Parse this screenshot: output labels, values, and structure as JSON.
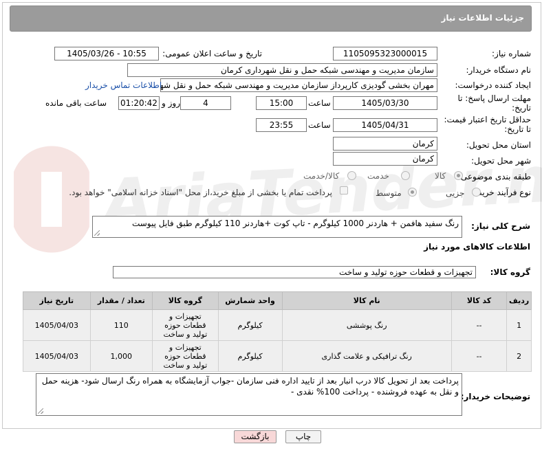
{
  "header": {
    "title": "جزئیات اطلاعات نیاز"
  },
  "fields": {
    "need_number_label": "شماره نیاز:",
    "need_number_value": "1105095323000015",
    "announce_label": "تاریخ و ساعت اعلان عمومی:",
    "announce_value": "1405/03/26 - 10:55",
    "buyer_org_label": "نام دستگاه خریدار:",
    "buyer_org_value": "سازمان مدیریت و مهندسی شبکه حمل و نقل شهرداری کرمان",
    "requester_label": "ایجاد کننده درخواست:",
    "requester_value": "مهران بخشی گودیزی کارپرداز سازمان مدیریت و مهندسی شبکه حمل و نقل شهرداری کرمان",
    "contact_link": "اطلاعات تماس خریدار",
    "deadline_label_1": "مهلت ارسال پاسخ: تا",
    "deadline_label_2": "تاریخ:",
    "deadline_date": "1405/03/30",
    "time_label": "ساعت",
    "deadline_time": "15:00",
    "days_value": "4",
    "days_label": "روز و",
    "remaining_value": "01:20:42",
    "remaining_label": "ساعت باقی مانده",
    "validity_label_1": "حداقل تاریخ اعتبار قیمت:",
    "validity_label_2": "تا تاریخ:",
    "validity_date": "1405/04/31",
    "validity_time": "23:55",
    "province_label": "استان محل تحویل:",
    "province_value": "کرمان",
    "city_label": "شهر محل تحویل:",
    "city_value": "کرمان",
    "category_label": "طبقه بندی موضوعی:",
    "category_options": [
      "کالا",
      "خدمت",
      "کالا/خدمت"
    ],
    "category_selected": "کالا",
    "process_label": "نوع فرآیند خرید :",
    "process_options": [
      "جزیی",
      "متوسط"
    ],
    "process_selected": "متوسط",
    "payment_note": "پرداخت تمام یا بخشی از مبلغ خرید،از محل \"اسناد خزانه اسلامی\" خواهد بود."
  },
  "description": {
    "label": "شرح کلی نیاز:",
    "value": "رنگ سفید هافمن + هاردنر 1000 کیلوگرم - تاپ کوت +هاردنر 110 کیلوگرم طبق فایل پیوست"
  },
  "goods_section": {
    "title": "اطلاعات کالاهای مورد نیاز",
    "group_label": "گروه کالا:",
    "group_value": "تجهیزات و قطعات حوزه تولید و ساخت"
  },
  "table": {
    "headers": [
      "ردیف",
      "کد کالا",
      "نام کالا",
      "واحد شمارش",
      "گروه کالا",
      "تعداد / مقدار",
      "تاریخ نیاز"
    ],
    "rows": [
      {
        "row": "1",
        "code": "--",
        "name": "رنگ پوششی",
        "unit": "کیلوگرم",
        "group": "تجهیزات و قطعات حوزه تولید و ساخت",
        "qty": "110",
        "date": "1405/04/03"
      },
      {
        "row": "2",
        "code": "--",
        "name": "رنگ ترافیکی و علامت گذاری",
        "unit": "کیلوگرم",
        "group": "تجهیزات و قطعات حوزه تولید و ساخت",
        "qty": "1,000",
        "date": "1405/04/03"
      }
    ]
  },
  "buyer_notes": {
    "label": "توضیحات خریدار:",
    "value": "پرداخت بعد از تحویل کالا درب انبار بعد از تایید اداره فنی سازمان -جواب آزمایشگاه به همراه رنگ ارسال شود- هزینه حمل و نقل به عهده فروشنده - پرداخت 100% نقدی -"
  },
  "buttons": {
    "print": "چاپ",
    "back": "بازگشت"
  },
  "watermark": "AriaTender.net",
  "colors": {
    "header_bg": "#9b9b9b",
    "link": "#1a4fa8",
    "back_button_bg": "#f8d8d8",
    "table_header_bg": "#d2d2d2"
  }
}
